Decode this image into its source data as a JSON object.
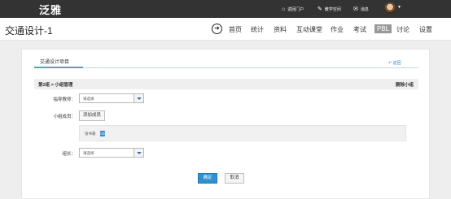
{
  "topbar": {
    "brand": "泛雅",
    "links": [
      {
        "icon": "home-icon",
        "glyph": "⌂",
        "label": "返回门户"
      },
      {
        "icon": "edit-icon",
        "glyph": "✎",
        "label": "教学空间"
      },
      {
        "icon": "mail-icon",
        "glyph": "✉",
        "label": "消息"
      }
    ]
  },
  "course": {
    "title": "交通设计-1",
    "nav": [
      "首页",
      "统计",
      "资料",
      "互动课堂",
      "作业",
      "考试",
      "PBL",
      "讨论",
      "设置"
    ],
    "active": "PBL"
  },
  "tab": {
    "label": "交通设计项目",
    "back": "返回"
  },
  "group": {
    "title": "第2组 > 小组管理",
    "delete": "删除小组",
    "teacher_label": "指导教师：",
    "teacher_value": "请选择",
    "members_label": "小组成员：",
    "add_member": "添加成员",
    "members": [
      "张书豪"
    ],
    "leader_label": "组长：",
    "leader_value": "请选择"
  },
  "actions": {
    "confirm": "确定",
    "cancel": "取消"
  },
  "colors": {
    "topbar": "#333333",
    "primary": "#2e8fd1",
    "active_nav": "#999999"
  }
}
